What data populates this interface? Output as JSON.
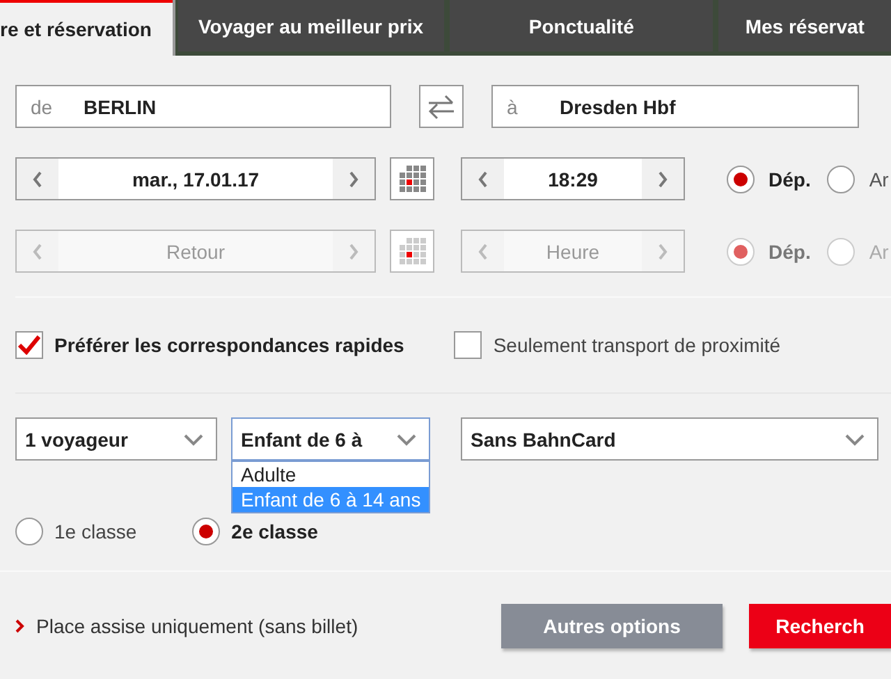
{
  "tabs": [
    {
      "label": "re et réservation",
      "selected": true
    },
    {
      "label": "Voyager au meilleur prix",
      "selected": false
    },
    {
      "label": "Ponctualité",
      "selected": false
    },
    {
      "label": "Mes réservat",
      "selected": false
    }
  ],
  "from": {
    "label": "de",
    "value": "BERLIN"
  },
  "to": {
    "label": "à",
    "value": "Dresden Hbf"
  },
  "journeys": [
    {
      "date": {
        "value": "mar., 17.01.17"
      },
      "time": {
        "value": "18:29"
      },
      "disabled": false,
      "directions": [
        {
          "label": "Dép.",
          "selected": true
        },
        {
          "label": "Ar",
          "selected": false
        }
      ]
    },
    {
      "date": {
        "placeholder": "Retour"
      },
      "time": {
        "placeholder": "Heure"
      },
      "disabled": true,
      "directions": [
        {
          "label": "Dép.",
          "selected": true
        },
        {
          "label": "Ar",
          "selected": false
        }
      ]
    }
  ],
  "checkboxes": [
    {
      "label": "Préférer les correspondances rapides",
      "checked": true
    },
    {
      "label": "Seulement transport de proximité",
      "checked": false
    }
  ],
  "selects": [
    {
      "value": "1 voyageur"
    },
    {
      "value": "Enfant de 6 à",
      "expanded": true,
      "options": [
        {
          "label": "Adulte",
          "selected": false
        },
        {
          "label": "Enfant de 6 à 14 ans",
          "selected": true
        }
      ]
    },
    {
      "value": "Sans BahnCard"
    }
  ],
  "classes": [
    {
      "label": "1e classe",
      "selected": false
    },
    {
      "label": "2e classe",
      "selected": true
    }
  ],
  "seat_link": "Place assise uniquement (sans billet)",
  "buttons": [
    {
      "label": "Autres options",
      "kind": "secondary"
    },
    {
      "label": "Recherch",
      "kind": "primary"
    }
  ]
}
